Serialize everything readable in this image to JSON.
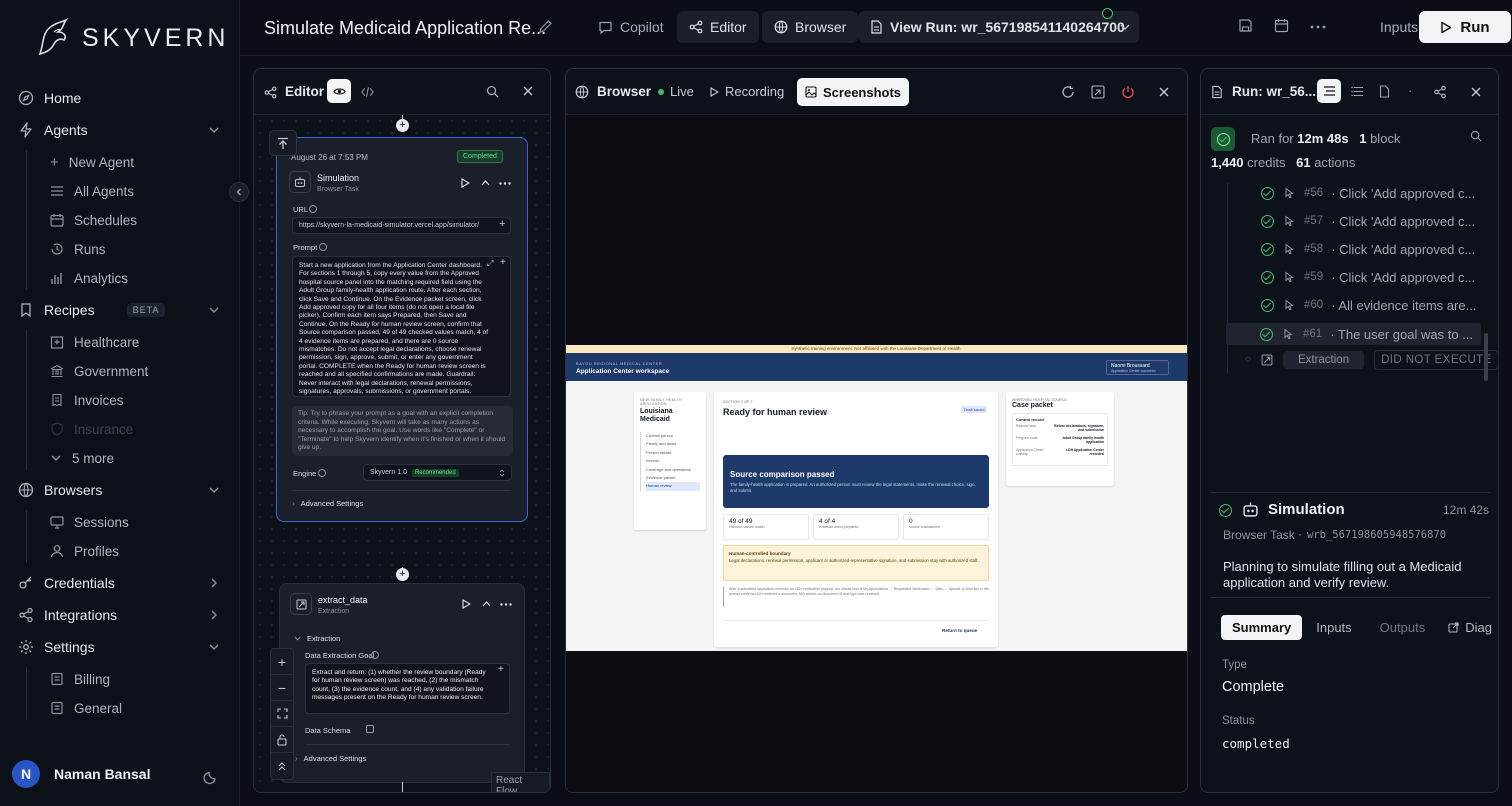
{
  "brand": {
    "name": "SKYVERN"
  },
  "sidebar": {
    "home": "Home",
    "agents": "Agents",
    "agents_items": [
      "New Agent",
      "All Agents",
      "Schedules",
      "Runs",
      "Analytics"
    ],
    "recipes": "Recipes",
    "recipes_badge": "BETA",
    "recipes_items": [
      "Healthcare",
      "Government",
      "Invoices",
      "Insurance",
      "5 more"
    ],
    "browsers": "Browsers",
    "browsers_items": [
      "Sessions",
      "Profiles"
    ],
    "credentials": "Credentials",
    "integrations": "Integrations",
    "settings": "Settings",
    "settings_items": [
      "Billing",
      "General"
    ],
    "user": {
      "initial": "N",
      "name": "Naman Bansal"
    }
  },
  "topbar": {
    "title": "Simulate Medicaid Application Re...",
    "copilot": "Copilot",
    "editor": "Editor",
    "browser": "Browser",
    "view_run": "View Run: wr_567198541140264700",
    "inputs": "Inputs",
    "run": "Run"
  },
  "editor": {
    "header": "Editor",
    "node1": {
      "date": "August 26 at 7:53 PM",
      "status": "Completed",
      "title": "Simulation",
      "subtitle": "Browser Task",
      "url_label": "URL",
      "url": "https://skyvern-la-medicaid-simulator.vercel.app/simulator/",
      "prompt_label": "Prompt",
      "prompt": "Start a new application from the Application Center dashboard. For sections 1 through 5, copy every value from the Approved hospital source panel into the matching required field using the Adult Group family-health application route. After each section, click Save and Continue. On the Evidence packet screen, click Add approved copy for all four items (do not open a local file picker). Confirm each item says Prepared, then Save and Continue. On the Ready for human review screen, confirm that Source comparison passed, 49 of 49 checked values match, 4 of 4 evidence items are prepared, and there are 0 source mismatches. Do not accept legal declarations, choose renewal permission, sign, approve, submit, or enter any government portal. COMPLETE when the Ready for human review screen is reached and all specified confirmations are made. Guardrail: Never interact with legal declarations, renewal permissions, signatures, approvals, submissions, or government portals.",
      "tip": "Tip: Try to phrase your prompt as a goal with an explicit completion criteria. While executing, Skyvern will take as many actions as necessary to accomplish the goal. Use words like \"Complete\" or \"Terminate\" to help Skyvern identify when it's finished or when it should give up.",
      "engine_label": "Engine",
      "engine_value": "Skyvern 1.0",
      "engine_badge": "Recommended",
      "advanced": "Advanced Settings"
    },
    "node2": {
      "title": "extract_data",
      "subtitle": "Extraction",
      "section": "Extraction",
      "goal_label": "Data Extraction Goal",
      "goal": "Extract and return: (1) whether the review boundary (Ready for human review screen) was reached, (2) the mismatch count, (3) the evidence count, and (4) any validation failure messages present on the Ready for human review screen.",
      "schema_label": "Data Schema",
      "advanced": "Advanced Settings"
    },
    "react_flow": "React Flow"
  },
  "browser": {
    "header": "Browser",
    "live": "Live",
    "recording": "Recording",
    "screenshots": "Screenshots",
    "shot": {
      "banner": "Synthetic training environment. Not affiliated with the Louisiana Department of Health.",
      "org": "BAYOU REGIONAL MEDICAL CENTER",
      "workspace": "Application Center workspace",
      "user": "Naomi Broussard",
      "user_role": "Application Center counselor",
      "left_kicker": "NEW FAMILY HEALTH APPLICATION",
      "left_title": "Louisiana Medicaid",
      "steps": [
        "Contact person",
        "Family and taxes",
        "Person details",
        "Income",
        "Coverage and operations",
        "Evidence packet",
        "Human review"
      ],
      "section": "SECTION 7 OF 7",
      "heading": "Ready for human review",
      "draft": "Draft saved",
      "pass_title": "Source comparison passed",
      "pass_text": "The family-health application is prepared. An authorized person must review the legal statements, make the renewal choice, sign, and submit.",
      "stats": [
        {
          "value": "49 of 49",
          "label": "checked values match"
        },
        {
          "value": "4 of 4",
          "label": "evidence items prepared"
        },
        {
          "value": "0",
          "label": "source mismatches"
        }
      ],
      "boundary_title": "Human-controlled boundary",
      "boundary_text": "Legal declarations, renewal permission, applicant or authorized-representative signature, and submission stay with authorized staff.",
      "note": "After a submitted application receives an LDH verification request, the official flow is My Applications → Requested Verification → View → Upload. A View link in the receipt confirms LDH received a document; NIA means no document of that type was received.",
      "return": "Return to queue",
      "source_kicker": "APPROVED HOSPITAL SOURCE",
      "source_title": "Case packet",
      "control": "Control record",
      "rows": [
        {
          "k": "Request stop",
          "v": "Before declarations, signature, and submission"
        },
        {
          "k": "Program route",
          "v": "Adult Group family health application"
        },
        {
          "k": "Application Center custody",
          "v": "LDH Application Center recorded"
        }
      ]
    }
  },
  "run": {
    "header": "Run: wr_56...",
    "ran_for_prefix": "Ran for",
    "duration": "12m 48s",
    "blocks": "1",
    "blocks_label": "block",
    "credits": "1,440",
    "credits_label": "credits",
    "actions": "61",
    "actions_label": "actions",
    "items": [
      {
        "id": "#56",
        "text": "· Click 'Add approved c..."
      },
      {
        "id": "#57",
        "text": "· Click 'Add approved c..."
      },
      {
        "id": "#58",
        "text": "· Click 'Add approved c..."
      },
      {
        "id": "#59",
        "text": "· Click 'Add approved c..."
      },
      {
        "id": "#60",
        "text": "· All evidence items are..."
      },
      {
        "id": "#61",
        "text": "· The user goal was to ..."
      }
    ],
    "extraction": "Extraction",
    "not_executed": "DID NOT EXECUTE",
    "block_title": "Simulation",
    "block_time": "12m 42s",
    "block_type": "Browser Task",
    "block_id": "wrb_567198605948576870",
    "block_desc": "Planning to simulate filling out a Medicaid application and verify review.",
    "tabs": [
      "Summary",
      "Inputs",
      "Outputs",
      "Diag"
    ],
    "type_label": "Type",
    "type_value": "Complete",
    "status_label": "Status",
    "status_value": "completed"
  }
}
